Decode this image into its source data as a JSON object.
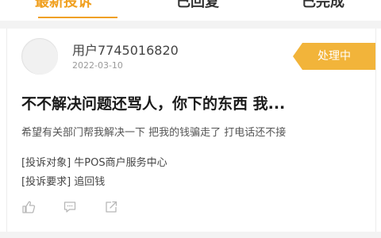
{
  "tabs": [
    {
      "label": "最新投诉",
      "active": true
    },
    {
      "label": "已回复",
      "active": false
    },
    {
      "label": "已完成",
      "active": false
    }
  ],
  "colors": {
    "accent": "#f0a020",
    "badge": "#f2b43a"
  },
  "complaint": {
    "username": "用户7745016820",
    "date": "2022-03-10",
    "status": "处理中",
    "title": "不不解决问题还骂人，你下的东西 我...",
    "description": "希望有关部门帮我解决一下 把我的钱骗走了 打电话还不接",
    "target_line": "[投诉对象] 牛POS商户服务中心",
    "request_line": "[投诉要求] 追回钱",
    "actions": {
      "like_icon": "thumbs-up-icon",
      "comment_icon": "comment-icon",
      "share_icon": "share-icon"
    }
  }
}
